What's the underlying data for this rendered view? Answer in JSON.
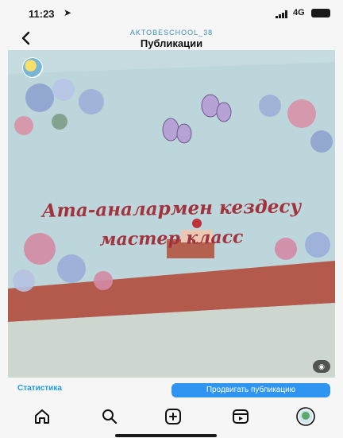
{
  "status_bar": {
    "time": "11:23",
    "location_icon": "location-arrow-icon",
    "network": "4G"
  },
  "header": {
    "account_name": "AKTOBESCHOOL_38",
    "title": "Публикации",
    "back_icon": "chevron-left-icon"
  },
  "post": {
    "photo_text_line1": "Ата-аналармен кездесу",
    "photo_text_line2": "мастер класс",
    "video_badge": "◉"
  },
  "actions": {
    "statistics_label": "Статистика",
    "promote_label": "Продвигать публикацию"
  },
  "nav": {
    "items": [
      "home-icon",
      "search-icon",
      "create-post-icon",
      "reels-icon",
      "profile-avatar-icon"
    ]
  },
  "colors": {
    "accent_blue": "#2f95f0",
    "link_blue": "#1b9be6",
    "headline_red": "#a2333d"
  }
}
